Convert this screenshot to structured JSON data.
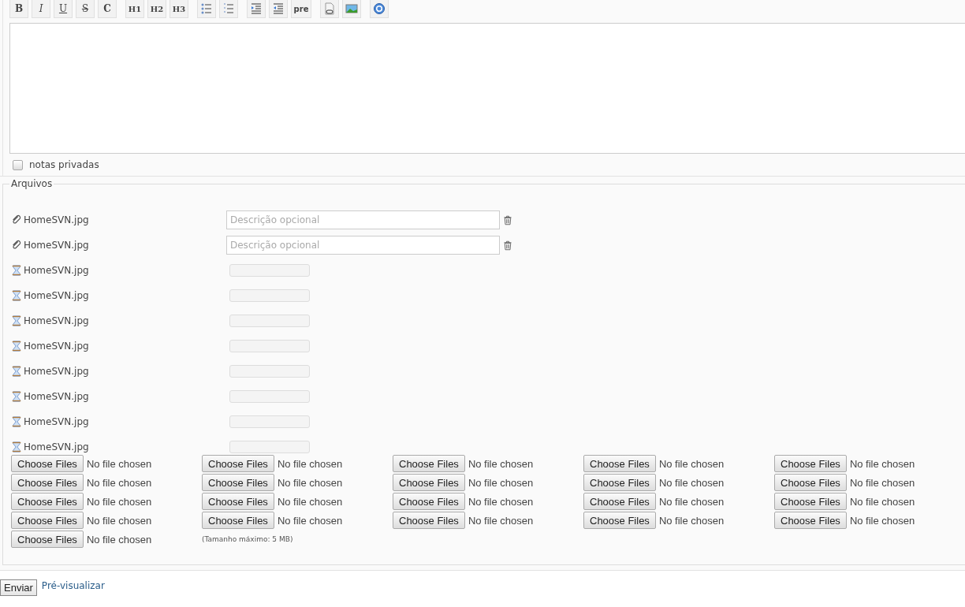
{
  "toolbar": {
    "groups": [
      [
        {
          "kind": "bold",
          "label": "B"
        },
        {
          "kind": "italic",
          "label": "I"
        },
        {
          "kind": "underline",
          "label": "U"
        },
        {
          "kind": "strike",
          "label": "S"
        },
        {
          "kind": "code",
          "label": "C"
        }
      ],
      [
        {
          "kind": "plain",
          "label": "H1"
        },
        {
          "kind": "plain",
          "label": "H2"
        },
        {
          "kind": "plain",
          "label": "H3"
        }
      ],
      [
        {
          "kind": "bullets"
        },
        {
          "kind": "numbers"
        }
      ],
      [
        {
          "kind": "indent"
        },
        {
          "kind": "outdent"
        },
        {
          "kind": "plain",
          "label": "pre"
        }
      ],
      [
        {
          "kind": "link"
        },
        {
          "kind": "image"
        }
      ],
      [
        {
          "kind": "help"
        }
      ]
    ]
  },
  "private_notes": {
    "label": "notas privadas",
    "checked": false
  },
  "attachments": {
    "legend": "Arquivos",
    "files": [
      {
        "kind": "attached",
        "name": "HomeSVN.jpg",
        "placeholder": "Descrição opcional"
      },
      {
        "kind": "attached",
        "name": "HomeSVN.jpg",
        "placeholder": "Descrição opcional"
      },
      {
        "kind": "pending",
        "name": "HomeSVN.jpg",
        "level": 0
      },
      {
        "kind": "pending",
        "name": "HomeSVN.jpg",
        "level": 0
      },
      {
        "kind": "pending",
        "name": "HomeSVN.jpg",
        "level": 0
      },
      {
        "kind": "pending",
        "name": "HomeSVN.jpg",
        "level": 0
      },
      {
        "kind": "pending",
        "name": "HomeSVN.jpg",
        "level": 0
      },
      {
        "kind": "pending",
        "name": "HomeSVN.jpg",
        "level": 0
      },
      {
        "kind": "pending",
        "name": "HomeSVN.jpg",
        "level": 0
      },
      {
        "kind": "pending",
        "name": "HomeSVN.jpg",
        "level": 0
      }
    ],
    "file_inputs": [
      {
        "button": "Choose Files",
        "status": "No file chosen"
      },
      {
        "button": "Choose Files",
        "status": "No file chosen"
      },
      {
        "button": "Choose Files",
        "status": "No file chosen"
      },
      {
        "button": "Choose Files",
        "status": "No file chosen"
      },
      {
        "button": "Choose Files",
        "status": "No file chosen"
      },
      {
        "button": "Choose Files",
        "status": "No file chosen"
      },
      {
        "button": "Choose Files",
        "status": "No file chosen"
      },
      {
        "button": "Choose Files",
        "status": "No file chosen"
      },
      {
        "button": "Choose Files",
        "status": "No file chosen"
      },
      {
        "button": "Choose Files",
        "status": "No file chosen"
      },
      {
        "button": "Choose Files",
        "status": "No file chosen"
      },
      {
        "button": "Choose Files",
        "status": "No file chosen"
      },
      {
        "button": "Choose Files",
        "status": "No file chosen"
      },
      {
        "button": "Choose Files",
        "status": "No file chosen"
      },
      {
        "button": "Choose Files",
        "status": "No file chosen"
      },
      {
        "button": "Choose Files",
        "status": "No file chosen"
      },
      {
        "button": "Choose Files",
        "status": "No file chosen"
      },
      {
        "button": "Choose Files",
        "status": "No file chosen"
      },
      {
        "button": "Choose Files",
        "status": "No file chosen"
      },
      {
        "button": "Choose Files",
        "status": "No file chosen"
      },
      {
        "button": "Choose Files",
        "status": "No file chosen"
      }
    ],
    "max_size_note": "(Tamanho máximo: 5 MB)"
  },
  "actions": {
    "submit": "Enviar",
    "preview_link": "Pré-visualizar"
  }
}
